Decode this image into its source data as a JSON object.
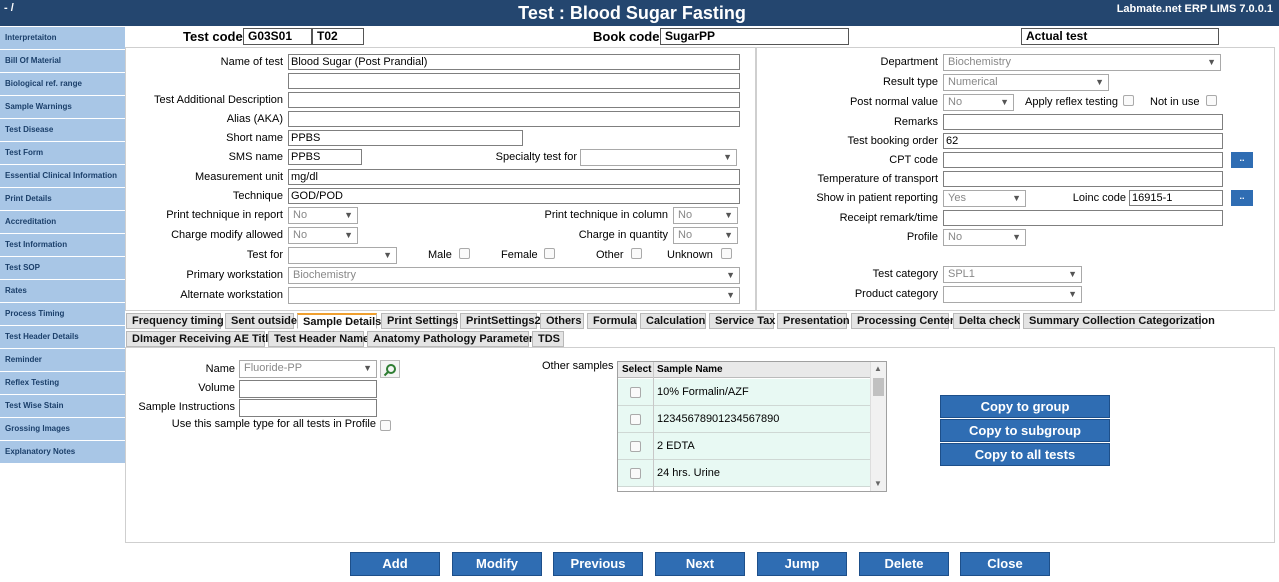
{
  "window": {
    "dash": "- /",
    "title": "Test : Blood Sugar Fasting",
    "version": "Labmate.net ERP LIMS 7.0.0.1"
  },
  "sidebar": {
    "items": [
      {
        "label": "Interpretaiton"
      },
      {
        "label": "Bill Of Material"
      },
      {
        "label": "Biological ref. range"
      },
      {
        "label": "Sample Warnings"
      },
      {
        "label": "Test Disease"
      },
      {
        "label": "Test Form"
      },
      {
        "label": "Essential Clinical Information"
      },
      {
        "label": "Print Details"
      },
      {
        "label": "Accreditation"
      },
      {
        "label": "Test Information"
      },
      {
        "label": "Test SOP"
      },
      {
        "label": "Rates"
      },
      {
        "label": "Process Timing"
      },
      {
        "label": "Test Header Details"
      },
      {
        "label": "Reminder"
      },
      {
        "label": "Reflex Testing"
      },
      {
        "label": "Test Wise Stain"
      },
      {
        "label": "Grossing Images"
      },
      {
        "label": "Explanatory Notes"
      }
    ]
  },
  "header": {
    "test_code_label": "Test code",
    "test_code_1": "G03S01",
    "test_code_2": "T02",
    "book_code_label": "Book code",
    "book_code": "SugarPP",
    "actual_test": "Actual test"
  },
  "left_form": {
    "name_of_test_label": "Name of test",
    "name_of_test": "Blood Sugar (Post Prandial)",
    "additional_desc_label": "Test Additional Description",
    "alias_label": "Alias (AKA)",
    "short_name_label": "Short name",
    "short_name": "PPBS",
    "sms_name_label": "SMS name",
    "sms_name": "PPBS",
    "specialty_label": "Specialty test for",
    "unit_label": "Measurement unit",
    "unit": "mg/dl",
    "technique_label": "Technique",
    "technique": "GOD/POD",
    "print_tech_report_label": "Print technique in report",
    "print_tech_report": "No",
    "print_tech_column_label": "Print technique in column",
    "print_tech_column": "No",
    "charge_modify_label": "Charge modify allowed",
    "charge_modify": "No",
    "charge_qty_label": "Charge in quantity",
    "charge_qty": "No",
    "test_for_label": "Test for",
    "male_label": "Male",
    "female_label": "Female",
    "other_label": "Other",
    "unknown_label": "Unknown",
    "primary_ws_label": "Primary workstation",
    "primary_ws": "Biochemistry",
    "alternate_ws_label": "Alternate workstation"
  },
  "right_form": {
    "department_label": "Department",
    "department": "Biochemistry",
    "result_type_label": "Result type",
    "result_type": "Numerical",
    "post_normal_label": "Post normal value",
    "post_normal": "No",
    "apply_reflex_label": "Apply reflex testing",
    "not_in_use_label": "Not in use",
    "remarks_label": "Remarks",
    "booking_order_label": "Test booking order",
    "booking_order": "62",
    "cpt_label": "CPT code",
    "temperature_label": "Temperature of transport",
    "show_patient_label": "Show in patient reporting",
    "show_patient": "Yes",
    "loinc_label": "Loinc code",
    "loinc": "16915-1",
    "receipt_remark_label": "Receipt remark/time",
    "profile_label": "Profile",
    "profile": "No",
    "test_category_label": "Test category",
    "test_category": "SPL1",
    "product_category_label": "Product category",
    "dots": ".."
  },
  "tabs": {
    "row1": [
      "Frequency timing",
      "Sent outside",
      "Sample Details",
      "Print Settings",
      "PrintSettings2",
      "Others",
      "Formula",
      "Calculation",
      "Service Tax",
      "Presentation",
      "Processing Center",
      "Delta check",
      "Summary Collection Categorization"
    ],
    "row2": [
      "DImager Receiving AE Title",
      "Test Header Name",
      "Anatomy Pathology Parameters",
      "TDS"
    ]
  },
  "sample": {
    "name_label": "Name",
    "name": "Fluoride-PP",
    "volume_label": "Volume",
    "instructions_label": "Sample Instructions",
    "use_all_label": "Use this sample type for all tests in Profile",
    "other_samples_label": "Other samples",
    "grid_headers": {
      "select": "Select",
      "name": "Sample Name"
    },
    "rows": [
      "10% Formalin/AZF",
      "12345678901234567890",
      "2 EDTA",
      "24 hrs. Urine"
    ],
    "copy_group": "Copy to group",
    "copy_subgroup": "Copy to subgroup",
    "copy_all": "Copy to all tests"
  },
  "footer": {
    "buttons": [
      "Add",
      "Modify",
      "Previous",
      "Next",
      "Jump",
      "Delete",
      "Close"
    ]
  },
  "colors": {
    "titlebar": "#24466f",
    "sidebar": "#a8c6e6",
    "button": "#2f6db3",
    "grid_row": "#e8f9f3"
  }
}
